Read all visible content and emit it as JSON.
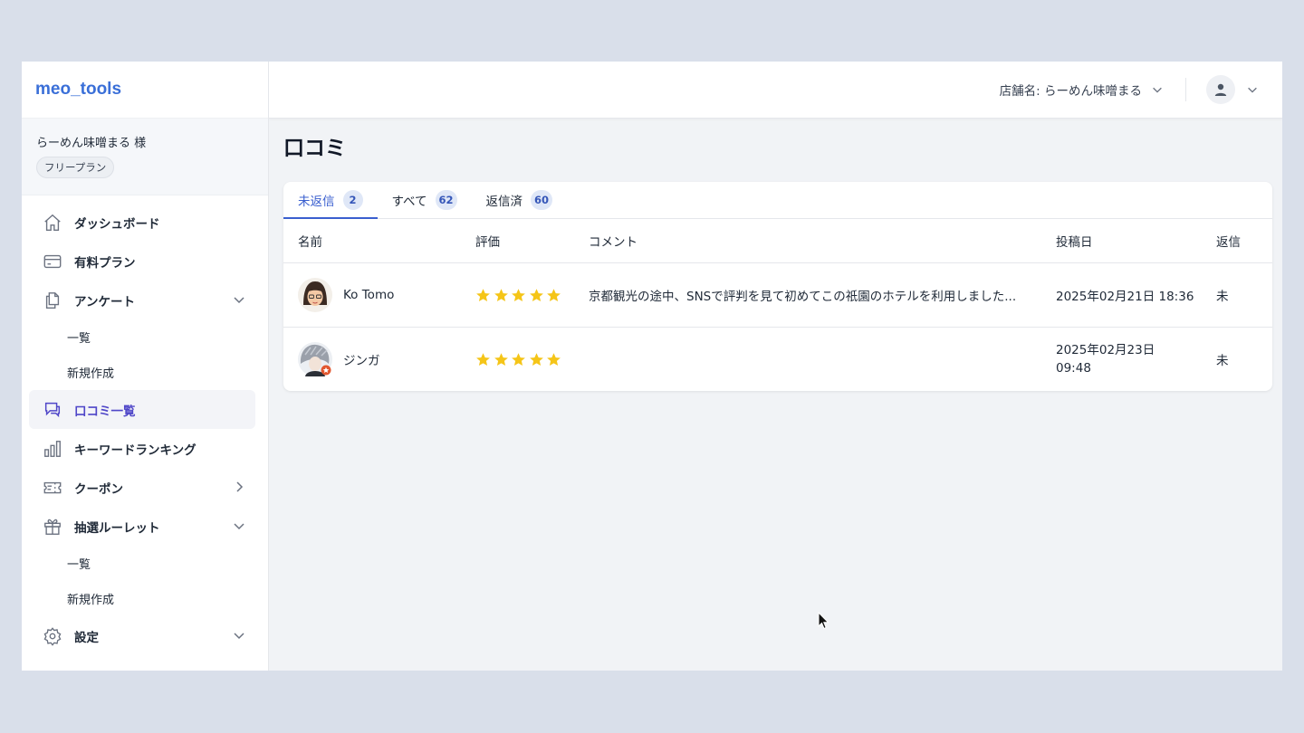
{
  "app": {
    "logo": "meo_tools"
  },
  "store": {
    "name": "らーめん味噌まる 様",
    "plan": "フリープラン"
  },
  "sidebar": {
    "items": [
      {
        "label": "ダッシュボード"
      },
      {
        "label": "有料プラン"
      },
      {
        "label": "アンケート"
      },
      {
        "label": "一覧"
      },
      {
        "label": "新規作成"
      },
      {
        "label": "口コミ一覧"
      },
      {
        "label": "キーワードランキング"
      },
      {
        "label": "クーポン"
      },
      {
        "label": "抽選ルーレット"
      },
      {
        "label": "一覧"
      },
      {
        "label": "新規作成"
      },
      {
        "label": "設定"
      }
    ]
  },
  "header": {
    "store_select": "店舗名: らーめん味噌まる"
  },
  "page": {
    "title": "口コミ"
  },
  "tabs": [
    {
      "label": "未返信",
      "count": "2"
    },
    {
      "label": "すべて",
      "count": "62"
    },
    {
      "label": "返信済",
      "count": "60"
    }
  ],
  "table": {
    "columns": [
      "名前",
      "評価",
      "コメント",
      "投稿日",
      "返信"
    ],
    "rows": [
      {
        "name": "Ko Tomo",
        "rating": 5,
        "comment": "京都観光の途中、SNSで評判を見て初めてこの祇園のホテルを利用しました...",
        "date": "2025年02月21日 18:36",
        "reply": "未"
      },
      {
        "name": "ジンガ",
        "rating": 5,
        "comment": "",
        "date_line1": "2025年02月23日",
        "date_line2": "09:48",
        "reply": "未"
      }
    ]
  },
  "colors": {
    "accent": "#3a5fcf",
    "logo": "#3a6fd8",
    "star": "#f5c518",
    "active_nav": "#4f46c8"
  }
}
